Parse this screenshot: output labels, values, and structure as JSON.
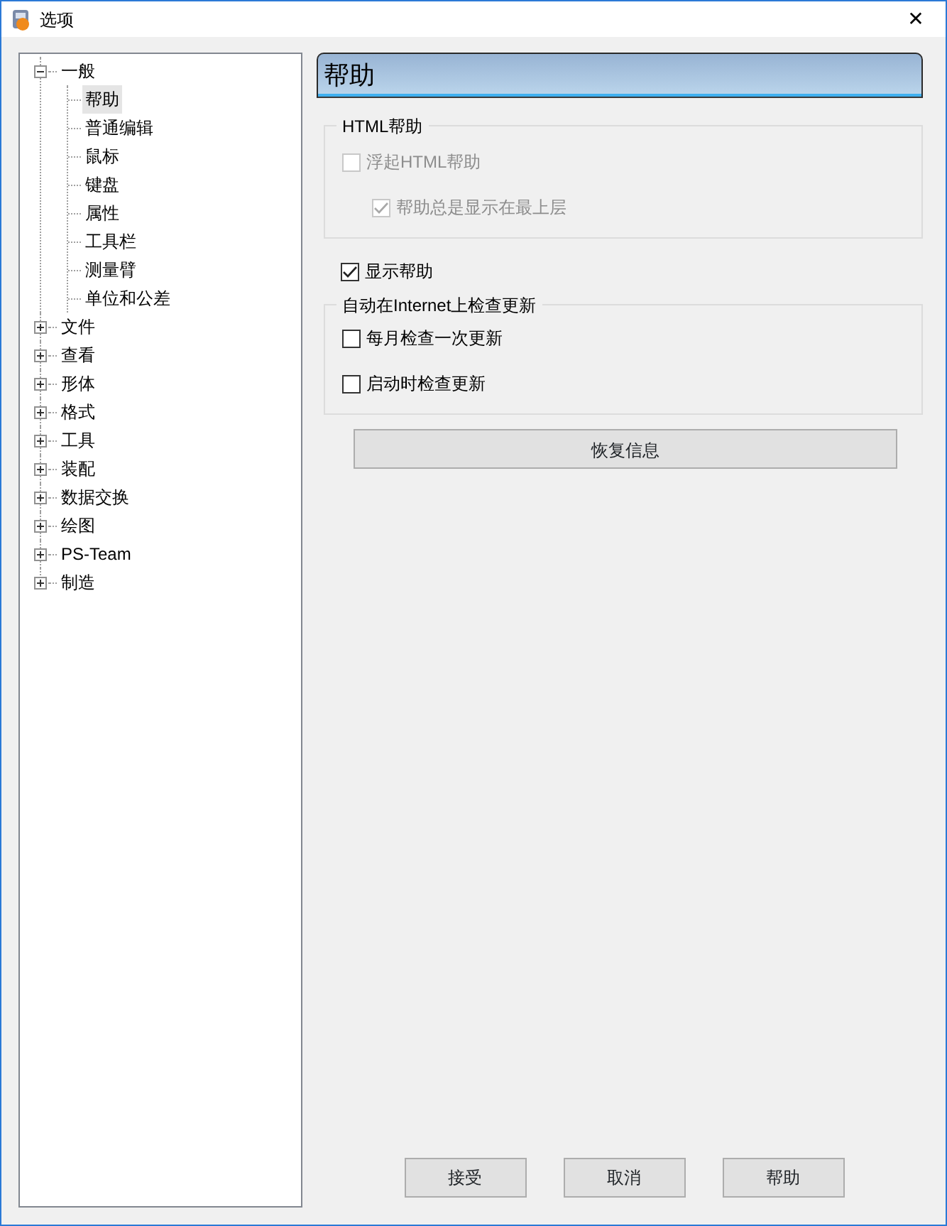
{
  "window": {
    "title": "选项",
    "close": "✕"
  },
  "tree": [
    {
      "label": "一般",
      "expanded": true,
      "children": [
        {
          "label": "帮助",
          "selected": true
        },
        {
          "label": "普通编辑",
          "selected": false
        },
        {
          "label": "鼠标",
          "selected": false
        },
        {
          "label": "键盘",
          "selected": false
        },
        {
          "label": "属性",
          "selected": false
        },
        {
          "label": "工具栏",
          "selected": false
        },
        {
          "label": "测量臂",
          "selected": false
        },
        {
          "label": "单位和公差",
          "selected": false
        }
      ]
    },
    {
      "label": "文件",
      "expanded": false
    },
    {
      "label": "查看",
      "expanded": false
    },
    {
      "label": "形体",
      "expanded": false
    },
    {
      "label": "格式",
      "expanded": false
    },
    {
      "label": "工具",
      "expanded": false
    },
    {
      "label": "装配",
      "expanded": false
    },
    {
      "label": "数据交换",
      "expanded": false
    },
    {
      "label": "绘图",
      "expanded": false
    },
    {
      "label": "PS-Team",
      "expanded": false
    },
    {
      "label": "制造",
      "expanded": false
    }
  ],
  "page_title": "帮助",
  "html_help": {
    "title": "HTML帮助",
    "options": [
      {
        "label": "浮起HTML帮助",
        "checked": false,
        "disabled": true,
        "children": [
          {
            "label": "帮助总是显示在最上层",
            "checked": true,
            "disabled": true
          }
        ]
      }
    ]
  },
  "show_help": {
    "label": "显示帮助",
    "checked": true,
    "disabled": false
  },
  "update_check": {
    "title": "自动在Internet上检查更新",
    "options": [
      {
        "label": "每月检查一次更新",
        "checked": false,
        "disabled": false
      },
      {
        "label": "启动时检查更新",
        "checked": false,
        "disabled": false
      }
    ]
  },
  "restore_button": "恢复信息",
  "buttons": [
    "接受",
    "取消",
    "帮助"
  ]
}
